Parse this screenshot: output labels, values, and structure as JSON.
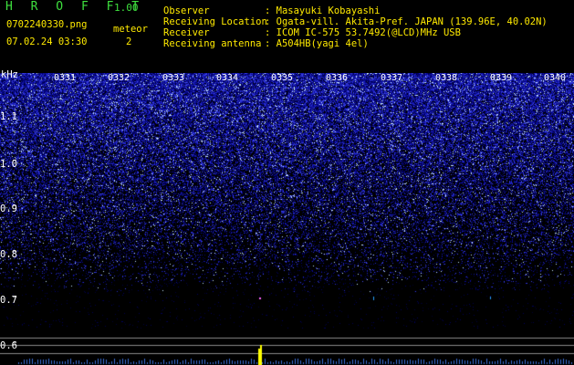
{
  "app": {
    "title": "H R O F F T",
    "version": "1.00"
  },
  "file": {
    "name": "0702240330.png",
    "datetime": "07.02.24 03:30"
  },
  "counter": {
    "label": "meteor",
    "value": "2"
  },
  "info": [
    {
      "key": "Observer",
      "value": ": Masayuki Kobayashi"
    },
    {
      "key": "Receiving Location",
      "value": ": Ogata-vill. Akita-Pref. JAPAN (139.96E, 40.02N)"
    },
    {
      "key": "Receiver",
      "value": ": ICOM IC-575 53.7492(@LCD)MHz USB"
    },
    {
      "key": "Receiving antenna",
      "value": ": A504HB(yagi 4el)"
    }
  ],
  "axis": {
    "unit": "kHz",
    "ticks": [
      "1.1",
      "1.0",
      "0.9",
      "0.8",
      "0.7",
      "0.6"
    ],
    "times": [
      "0331",
      "0332",
      "0333",
      "0334",
      "0335",
      "0336",
      "0337",
      "0338",
      "0339",
      "0340"
    ]
  },
  "colors": {
    "background": "#000000",
    "noise": "#2a2aff",
    "title": "#3ee03e",
    "header_text": "#ffea00",
    "echo": "#ffff00"
  }
}
